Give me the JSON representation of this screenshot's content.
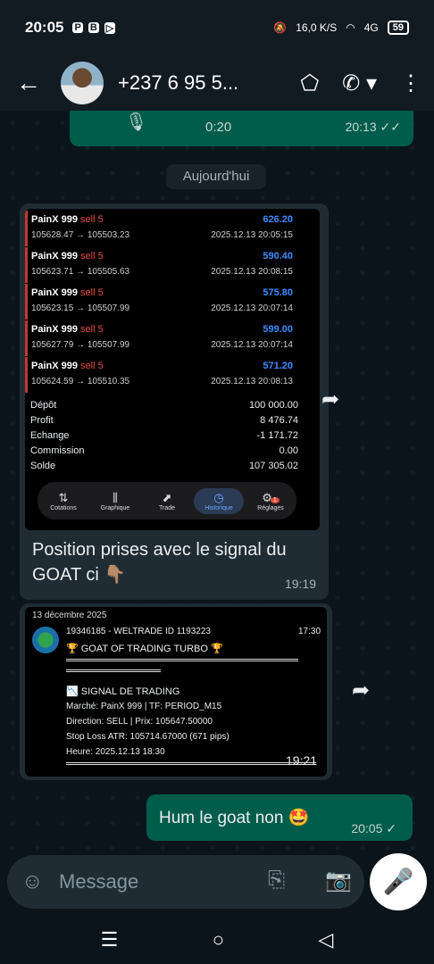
{
  "status": {
    "time": "20:05",
    "net_speed": "16,0 K/S",
    "signal": "4G",
    "battery": "59"
  },
  "header": {
    "contact": "+237 6 95 5..."
  },
  "chat": {
    "voice": {
      "duration": "0:20",
      "time": "20:13",
      "ticks": "✓✓"
    },
    "day_chip": "Aujourd'hui",
    "trades": [
      {
        "symbol": "PainX 999",
        "side": "sell 5",
        "value": "626.20",
        "prices": "105628.47 → 105503.23",
        "date": "2025.12.13 20:05:15"
      },
      {
        "symbol": "PainX 999",
        "side": "sell 5",
        "value": "590.40",
        "prices": "105623.71 → 105505.63",
        "date": "2025.12.13 20:08:15"
      },
      {
        "symbol": "PainX 999",
        "side": "sell 5",
        "value": "575.80",
        "prices": "105623.15 → 105507.99",
        "date": "2025.12.13 20:07:14"
      },
      {
        "symbol": "PainX 999",
        "side": "sell 5",
        "value": "599.00",
        "prices": "105627.79 → 105507.99",
        "date": "2025.12.13 20:07:14"
      },
      {
        "symbol": "PainX 999",
        "side": "sell 5",
        "value": "571.20",
        "prices": "105624.59 → 105510.35",
        "date": "2025.12.13 20:08:13"
      }
    ],
    "summary": [
      {
        "label": "Dépôt",
        "value": "100 000.00"
      },
      {
        "label": "Profit",
        "value": "8 476.74"
      },
      {
        "label": "Echange",
        "value": "-1 171.72"
      },
      {
        "label": "Commission",
        "value": "0.00"
      },
      {
        "label": "Solde",
        "value": "107 305.02"
      }
    ],
    "app_tabs": [
      {
        "label": "Cotations",
        "icon": "⇅"
      },
      {
        "label": "Graphique",
        "icon": "⫼"
      },
      {
        "label": "Trade",
        "icon": "⬈"
      },
      {
        "label": "Historique",
        "icon": "◷"
      },
      {
        "label": "Réglages",
        "icon": "⚙"
      }
    ],
    "settings_badge": "1",
    "msg1": {
      "caption": "Position prises avec le signal du GOAT ci 👇🏽",
      "time": "19:19"
    },
    "msg2": {
      "date": "13 décembre 2025",
      "sender": "19346185 - WELTRADE ID 1193223",
      "sender_time": "17:30",
      "title": "🏆 GOAT OF TRADING TURBO 🏆",
      "signal_header": "📉 SIGNAL DE TRADING",
      "market": "Marché: PainX 999 | TF: PERIOD_M15",
      "direction": "Direction: SELL | Prix: 105647.50000",
      "stoploss": "Stop Loss ATR: 105714.67000 (671 pips)",
      "hour": "Heure: 2025.12.13 18:30",
      "time": "19:21"
    },
    "msg3": {
      "text": "Hum le goat non 🤩",
      "time": "20:05",
      "tick": "✓"
    }
  },
  "composer": {
    "placeholder": "Message"
  },
  "colors": {
    "outgoing": "#005c4b",
    "incoming": "#1f2c33",
    "background": "#0b141a"
  }
}
